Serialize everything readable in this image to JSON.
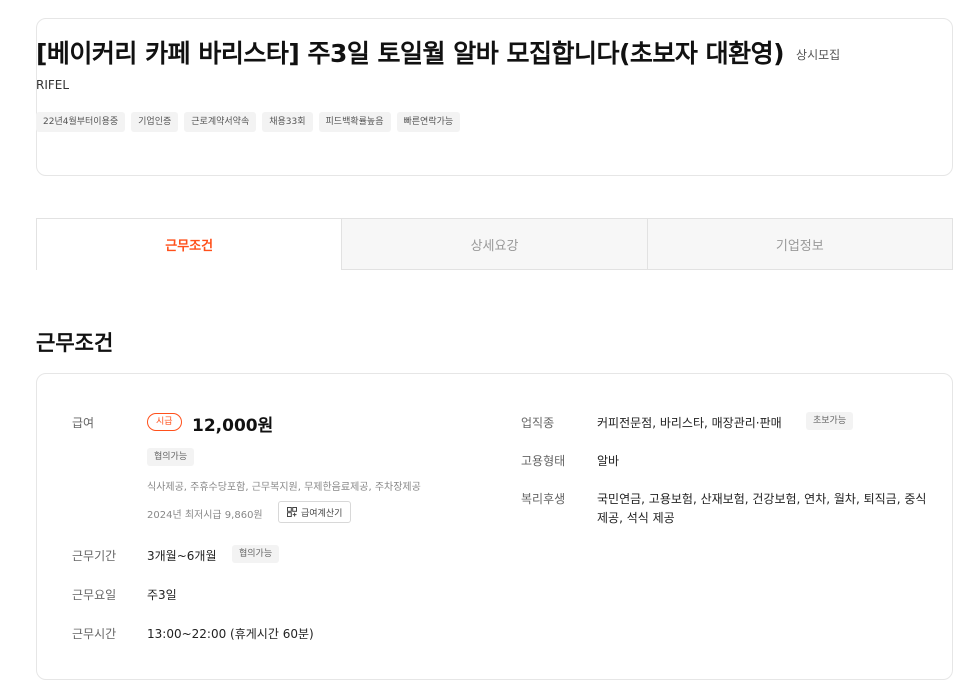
{
  "header": {
    "title": "[베이커리 카페 바리스타] 주3일 토일월 알바 모집합니다(초보자 대환영)",
    "recruit_status": "상시모집",
    "company": "RIFEL",
    "tags": [
      "22년4월부터이용중",
      "기업인증",
      "근로계약서약속",
      "채용33회",
      "피드백확률높음",
      "빠른연락가능"
    ]
  },
  "tabs": [
    {
      "label": "근무조건",
      "active": true
    },
    {
      "label": "상세요강",
      "active": false
    },
    {
      "label": "기업정보",
      "active": false
    }
  ],
  "section": {
    "title": "근무조건"
  },
  "conditions": {
    "pay": {
      "label": "급여",
      "unit": "시급",
      "amount": "12,000원",
      "negotiable": "협의가능",
      "benefits_note": "식사제공, 주휴수당포함, 근무복지원, 무제한음료제공, 주차장제공",
      "min_wage_note": "2024년 최저시급 9,860원",
      "calc_button": "급여계산기"
    },
    "period": {
      "label": "근무기간",
      "value": "3개월~6개월",
      "badge": "협의가능"
    },
    "days": {
      "label": "근무요일",
      "value": "주3일"
    },
    "hours": {
      "label": "근무시간",
      "value": "13:00~22:00 (휴게시간 60분)"
    },
    "job_type": {
      "label": "업직종",
      "value": "커피전문점, 바리스타, 매장관리·판매",
      "badge": "초보가능"
    },
    "employment": {
      "label": "고용형태",
      "value": "알바"
    },
    "welfare": {
      "label": "복리후생",
      "value": "국민연금, 고용보험, 산재보험, 건강보험, 연차, 월차, 퇴직금, 중식 제공, 석식 제공"
    }
  },
  "colors": {
    "accent": "#ff501b",
    "border": "#e6e6e6"
  }
}
